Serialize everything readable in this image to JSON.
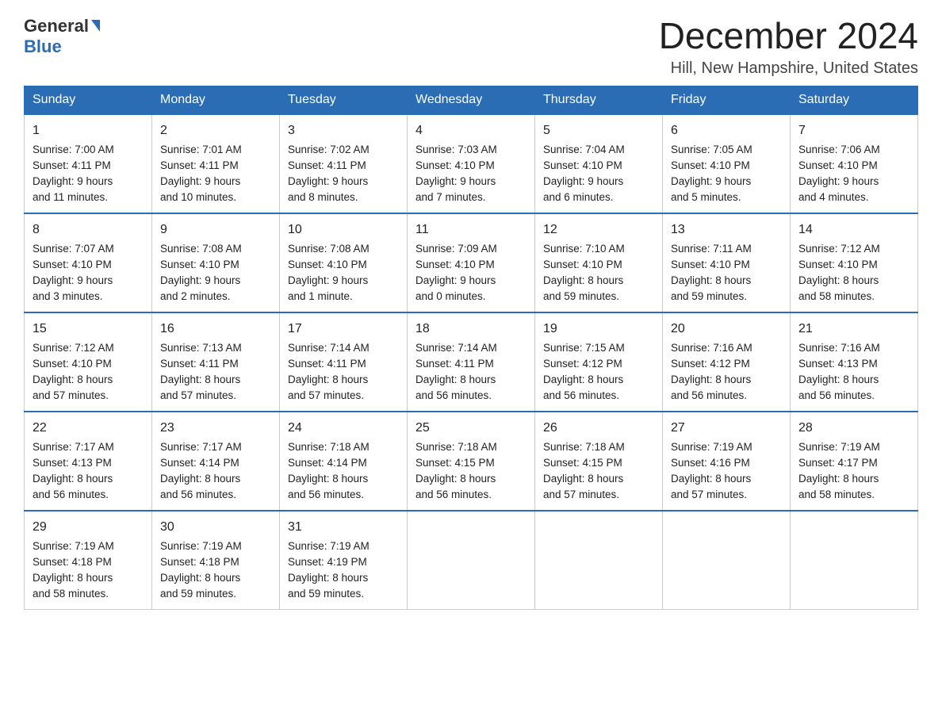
{
  "header": {
    "logo_general": "General",
    "logo_blue": "Blue",
    "title": "December 2024",
    "subtitle": "Hill, New Hampshire, United States"
  },
  "days_of_week": [
    "Sunday",
    "Monday",
    "Tuesday",
    "Wednesday",
    "Thursday",
    "Friday",
    "Saturday"
  ],
  "weeks": [
    [
      {
        "day": "1",
        "sunrise": "Sunrise: 7:00 AM",
        "sunset": "Sunset: 4:11 PM",
        "daylight": "Daylight: 9 hours",
        "daylight2": "and 11 minutes."
      },
      {
        "day": "2",
        "sunrise": "Sunrise: 7:01 AM",
        "sunset": "Sunset: 4:11 PM",
        "daylight": "Daylight: 9 hours",
        "daylight2": "and 10 minutes."
      },
      {
        "day": "3",
        "sunrise": "Sunrise: 7:02 AM",
        "sunset": "Sunset: 4:11 PM",
        "daylight": "Daylight: 9 hours",
        "daylight2": "and 8 minutes."
      },
      {
        "day": "4",
        "sunrise": "Sunrise: 7:03 AM",
        "sunset": "Sunset: 4:10 PM",
        "daylight": "Daylight: 9 hours",
        "daylight2": "and 7 minutes."
      },
      {
        "day": "5",
        "sunrise": "Sunrise: 7:04 AM",
        "sunset": "Sunset: 4:10 PM",
        "daylight": "Daylight: 9 hours",
        "daylight2": "and 6 minutes."
      },
      {
        "day": "6",
        "sunrise": "Sunrise: 7:05 AM",
        "sunset": "Sunset: 4:10 PM",
        "daylight": "Daylight: 9 hours",
        "daylight2": "and 5 minutes."
      },
      {
        "day": "7",
        "sunrise": "Sunrise: 7:06 AM",
        "sunset": "Sunset: 4:10 PM",
        "daylight": "Daylight: 9 hours",
        "daylight2": "and 4 minutes."
      }
    ],
    [
      {
        "day": "8",
        "sunrise": "Sunrise: 7:07 AM",
        "sunset": "Sunset: 4:10 PM",
        "daylight": "Daylight: 9 hours",
        "daylight2": "and 3 minutes."
      },
      {
        "day": "9",
        "sunrise": "Sunrise: 7:08 AM",
        "sunset": "Sunset: 4:10 PM",
        "daylight": "Daylight: 9 hours",
        "daylight2": "and 2 minutes."
      },
      {
        "day": "10",
        "sunrise": "Sunrise: 7:08 AM",
        "sunset": "Sunset: 4:10 PM",
        "daylight": "Daylight: 9 hours",
        "daylight2": "and 1 minute."
      },
      {
        "day": "11",
        "sunrise": "Sunrise: 7:09 AM",
        "sunset": "Sunset: 4:10 PM",
        "daylight": "Daylight: 9 hours",
        "daylight2": "and 0 minutes."
      },
      {
        "day": "12",
        "sunrise": "Sunrise: 7:10 AM",
        "sunset": "Sunset: 4:10 PM",
        "daylight": "Daylight: 8 hours",
        "daylight2": "and 59 minutes."
      },
      {
        "day": "13",
        "sunrise": "Sunrise: 7:11 AM",
        "sunset": "Sunset: 4:10 PM",
        "daylight": "Daylight: 8 hours",
        "daylight2": "and 59 minutes."
      },
      {
        "day": "14",
        "sunrise": "Sunrise: 7:12 AM",
        "sunset": "Sunset: 4:10 PM",
        "daylight": "Daylight: 8 hours",
        "daylight2": "and 58 minutes."
      }
    ],
    [
      {
        "day": "15",
        "sunrise": "Sunrise: 7:12 AM",
        "sunset": "Sunset: 4:10 PM",
        "daylight": "Daylight: 8 hours",
        "daylight2": "and 57 minutes."
      },
      {
        "day": "16",
        "sunrise": "Sunrise: 7:13 AM",
        "sunset": "Sunset: 4:11 PM",
        "daylight": "Daylight: 8 hours",
        "daylight2": "and 57 minutes."
      },
      {
        "day": "17",
        "sunrise": "Sunrise: 7:14 AM",
        "sunset": "Sunset: 4:11 PM",
        "daylight": "Daylight: 8 hours",
        "daylight2": "and 57 minutes."
      },
      {
        "day": "18",
        "sunrise": "Sunrise: 7:14 AM",
        "sunset": "Sunset: 4:11 PM",
        "daylight": "Daylight: 8 hours",
        "daylight2": "and 56 minutes."
      },
      {
        "day": "19",
        "sunrise": "Sunrise: 7:15 AM",
        "sunset": "Sunset: 4:12 PM",
        "daylight": "Daylight: 8 hours",
        "daylight2": "and 56 minutes."
      },
      {
        "day": "20",
        "sunrise": "Sunrise: 7:16 AM",
        "sunset": "Sunset: 4:12 PM",
        "daylight": "Daylight: 8 hours",
        "daylight2": "and 56 minutes."
      },
      {
        "day": "21",
        "sunrise": "Sunrise: 7:16 AM",
        "sunset": "Sunset: 4:13 PM",
        "daylight": "Daylight: 8 hours",
        "daylight2": "and 56 minutes."
      }
    ],
    [
      {
        "day": "22",
        "sunrise": "Sunrise: 7:17 AM",
        "sunset": "Sunset: 4:13 PM",
        "daylight": "Daylight: 8 hours",
        "daylight2": "and 56 minutes."
      },
      {
        "day": "23",
        "sunrise": "Sunrise: 7:17 AM",
        "sunset": "Sunset: 4:14 PM",
        "daylight": "Daylight: 8 hours",
        "daylight2": "and 56 minutes."
      },
      {
        "day": "24",
        "sunrise": "Sunrise: 7:18 AM",
        "sunset": "Sunset: 4:14 PM",
        "daylight": "Daylight: 8 hours",
        "daylight2": "and 56 minutes."
      },
      {
        "day": "25",
        "sunrise": "Sunrise: 7:18 AM",
        "sunset": "Sunset: 4:15 PM",
        "daylight": "Daylight: 8 hours",
        "daylight2": "and 56 minutes."
      },
      {
        "day": "26",
        "sunrise": "Sunrise: 7:18 AM",
        "sunset": "Sunset: 4:15 PM",
        "daylight": "Daylight: 8 hours",
        "daylight2": "and 57 minutes."
      },
      {
        "day": "27",
        "sunrise": "Sunrise: 7:19 AM",
        "sunset": "Sunset: 4:16 PM",
        "daylight": "Daylight: 8 hours",
        "daylight2": "and 57 minutes."
      },
      {
        "day": "28",
        "sunrise": "Sunrise: 7:19 AM",
        "sunset": "Sunset: 4:17 PM",
        "daylight": "Daylight: 8 hours",
        "daylight2": "and 58 minutes."
      }
    ],
    [
      {
        "day": "29",
        "sunrise": "Sunrise: 7:19 AM",
        "sunset": "Sunset: 4:18 PM",
        "daylight": "Daylight: 8 hours",
        "daylight2": "and 58 minutes."
      },
      {
        "day": "30",
        "sunrise": "Sunrise: 7:19 AM",
        "sunset": "Sunset: 4:18 PM",
        "daylight": "Daylight: 8 hours",
        "daylight2": "and 59 minutes."
      },
      {
        "day": "31",
        "sunrise": "Sunrise: 7:19 AM",
        "sunset": "Sunset: 4:19 PM",
        "daylight": "Daylight: 8 hours",
        "daylight2": "and 59 minutes."
      },
      {
        "day": "",
        "sunrise": "",
        "sunset": "",
        "daylight": "",
        "daylight2": ""
      },
      {
        "day": "",
        "sunrise": "",
        "sunset": "",
        "daylight": "",
        "daylight2": ""
      },
      {
        "day": "",
        "sunrise": "",
        "sunset": "",
        "daylight": "",
        "daylight2": ""
      },
      {
        "day": "",
        "sunrise": "",
        "sunset": "",
        "daylight": "",
        "daylight2": ""
      }
    ]
  ]
}
